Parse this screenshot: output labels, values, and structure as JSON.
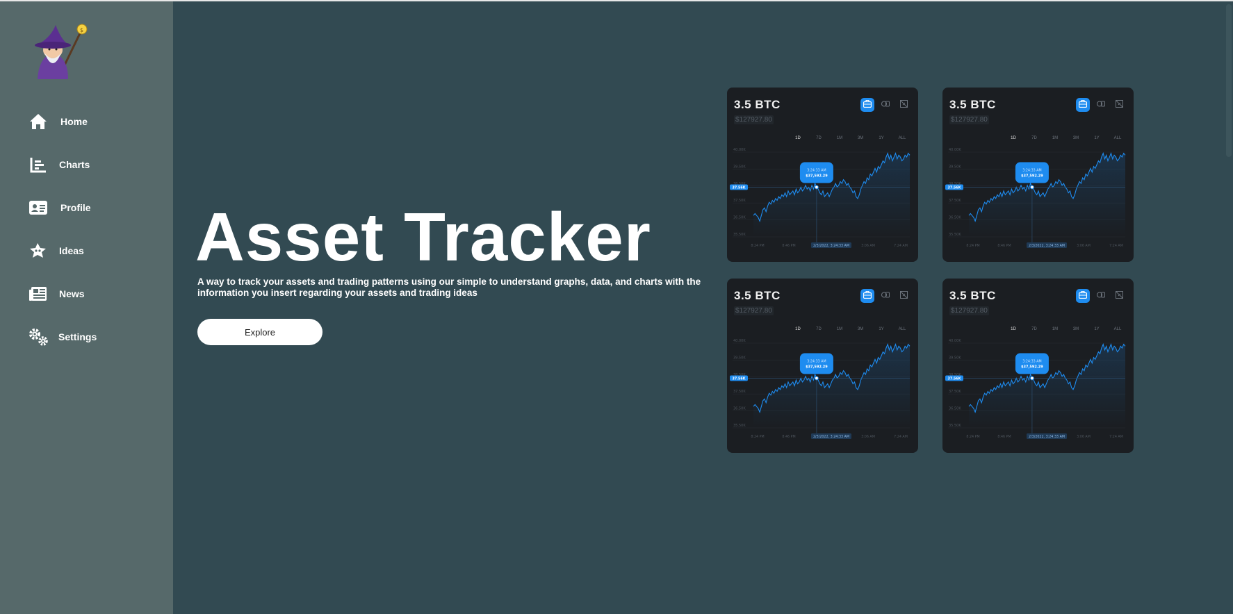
{
  "sidebar": {
    "logo": "wizard-mascot",
    "items": [
      {
        "label": "Home",
        "icon": "home-icon"
      },
      {
        "label": "Charts",
        "icon": "bar-chart-icon"
      },
      {
        "label": "Profile",
        "icon": "id-card-icon"
      },
      {
        "label": "Ideas",
        "icon": "idea-blob-icon"
      },
      {
        "label": "News",
        "icon": "newspaper-icon"
      },
      {
        "label": "Settings",
        "icon": "gears-icon"
      }
    ]
  },
  "hero": {
    "title": "Asset Tracker",
    "description": "A way to track your assets and trading patterns using our simple to understand graphs, data, and charts with the information you insert regarding your assets and trading ideas",
    "explore_label": "Explore"
  },
  "cards": [
    {
      "title": "3.5 BTC",
      "price": "$127927.80"
    },
    {
      "title": "3.5 BTC",
      "price": "$127927.80"
    },
    {
      "title": "3.5 BTC",
      "price": "$127927.80"
    },
    {
      "title": "3.5 BTC",
      "price": "$127927.80"
    }
  ],
  "card_widget": {
    "buttons": [
      "briefcase-icon",
      "exchange-icon",
      "expand-icon"
    ],
    "ranges": [
      "1D",
      "7D",
      "1M",
      "3M",
      "1Y",
      "ALL"
    ],
    "selected_range": "1D",
    "y_ticks": [
      "40.00K",
      "39.50K",
      "38.50K",
      "37.50K",
      "36.50K",
      "35.50K"
    ],
    "x_ticks": [
      "8:24 PM",
      "8:46 PM",
      "2/3/2022, 3:24:33 AM",
      "3:06 AM",
      "7:24 AM"
    ],
    "crosshair_label": "37.56K",
    "tooltip_time": "3:24:33 AM",
    "tooltip_value": "$37,592.29",
    "accent_color": "#1e8cf0",
    "card_bg": "#1b1e22"
  },
  "chart_data": {
    "type": "line",
    "x": [
      0,
      1,
      2,
      3,
      4,
      5,
      6,
      7,
      8,
      9,
      10,
      11,
      12,
      13,
      14,
      15,
      16,
      17,
      18,
      19,
      20,
      21,
      22,
      23,
      24,
      25,
      26,
      27,
      28,
      29,
      30,
      31,
      32,
      33,
      34,
      35,
      36,
      37,
      38,
      39,
      40,
      41,
      42,
      43,
      44,
      45,
      46,
      47,
      48,
      49,
      50,
      51,
      52,
      53,
      54,
      55,
      56,
      57,
      58,
      59,
      60,
      61,
      62,
      63,
      64,
      65,
      66,
      67,
      68,
      69,
      70,
      71,
      72,
      73,
      74,
      75,
      76,
      77,
      78,
      79,
      80,
      81,
      82,
      83,
      84,
      85,
      86,
      87,
      88,
      89,
      90,
      91,
      92,
      93,
      94,
      95,
      96,
      97,
      98,
      99
    ],
    "values": [
      36.6,
      36.7,
      36.6,
      36.5,
      36.3,
      36.6,
      36.9,
      37.0,
      36.8,
      37.1,
      37.3,
      37.2,
      37.4,
      37.3,
      37.5,
      37.4,
      37.6,
      37.5,
      37.7,
      37.6,
      37.8,
      37.6,
      37.9,
      37.7,
      37.8,
      37.9,
      37.7,
      38.0,
      37.8,
      37.9,
      38.1,
      37.9,
      38.0,
      38.2,
      38.0,
      38.1,
      37.9,
      38.2,
      38.0,
      38.3,
      38.1,
      38.0,
      37.8,
      37.7,
      37.9,
      37.6,
      37.7,
      37.8,
      37.6,
      37.8,
      38.0,
      38.1,
      38.3,
      38.1,
      38.2,
      38.4,
      38.3,
      38.5,
      38.4,
      38.2,
      38.3,
      38.1,
      38.0,
      37.8,
      37.9,
      37.6,
      37.5,
      37.7,
      38.0,
      38.2,
      38.4,
      38.3,
      38.6,
      38.5,
      38.8,
      38.7,
      38.9,
      39.1,
      38.9,
      39.2,
      39.1,
      39.3,
      39.5,
      39.4,
      39.7,
      39.9,
      39.6,
      39.8,
      39.5,
      39.7,
      39.9,
      39.6,
      39.8,
      39.7,
      39.5,
      39.6,
      39.8,
      39.7,
      39.9,
      39.8
    ],
    "ylim": [
      35.5,
      40.0
    ],
    "xlabel": "",
    "ylabel": "",
    "grid": true
  }
}
